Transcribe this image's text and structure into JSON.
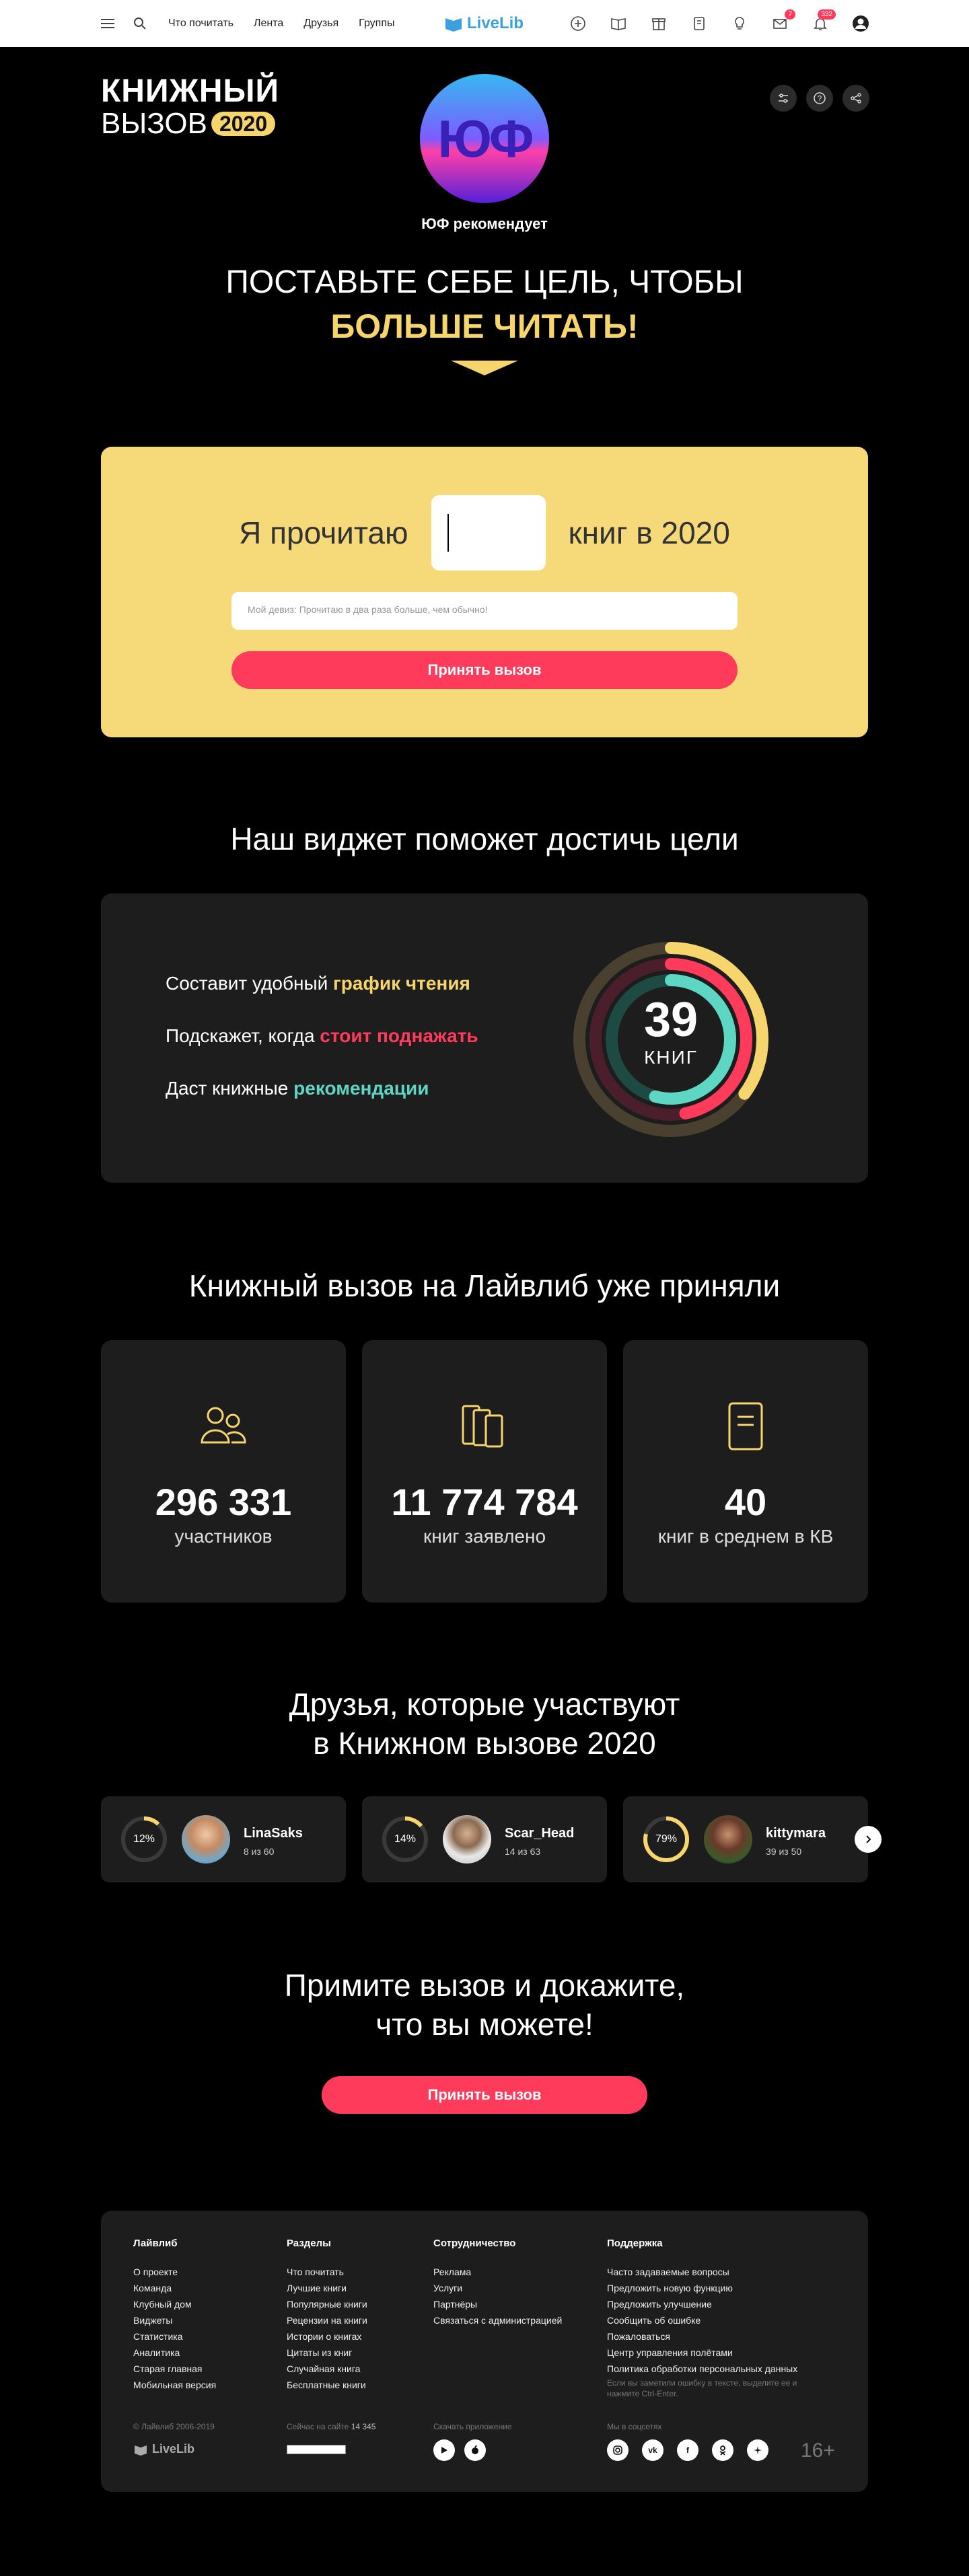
{
  "nav": {
    "links": [
      "Что почитать",
      "Лента",
      "Друзья",
      "Группы"
    ],
    "logo": "LiveLib",
    "messages_badge": "7",
    "notifications_badge": "332"
  },
  "hero": {
    "brand_line1": "КНИЖНЫЙ",
    "brand_line2": "ВЫЗОВ",
    "brand_year": "2020",
    "avatar_text": "ЮФ",
    "recommends": "ЮФ рекомендует",
    "headline1": "ПОСТАВЬТЕ СЕБЕ ЦЕЛЬ, ЧТОБЫ",
    "headline2": "БОЛЬШЕ ЧИТАТЬ!"
  },
  "goal": {
    "prefix": "Я прочитаю",
    "value": "",
    "suffix": "книг в 2020",
    "motto_placeholder": "Мой девиз: Прочитаю в два раза больше, чем обычно!",
    "button": "Принять вызов"
  },
  "widget": {
    "title": "Наш виджет поможет достичь цели",
    "line1_text": "Составит удобный ",
    "line1_hl": "график чтения",
    "line2_text": "Подскажет, когда ",
    "line2_hl": "стоит поднажать",
    "line3_text": "Даст книжные ",
    "line3_hl": "рекомендации",
    "ring_number": "39",
    "ring_unit": "КНИГ",
    "colors": {
      "yellow": "#f6d56c",
      "pink": "#ff3b5c",
      "teal": "#5ed6c4"
    }
  },
  "stats": {
    "title": "Книжный вызов на Лайвлиб уже приняли",
    "items": [
      {
        "num": "296 331",
        "label": "участников"
      },
      {
        "num": "11 774 784",
        "label": "книг заявлено"
      },
      {
        "num": "40",
        "label": "книг в среднем в КВ"
      }
    ]
  },
  "friends": {
    "title_line1": "Друзья, которые участвуют",
    "title_line2": "в Книжном вызове 2020",
    "items": [
      {
        "pct": "12%",
        "progress": 0.12,
        "name": "LinaSaks",
        "progress_text": "8 из 60"
      },
      {
        "pct": "14%",
        "progress": 0.14,
        "name": "Scar_Head",
        "progress_text": "14 из 63"
      },
      {
        "pct": "79%",
        "progress": 0.79,
        "name": "kittymara",
        "progress_text": "39 из 50"
      }
    ]
  },
  "cta": {
    "line1": "Примите вызов и докажите,",
    "line2": "что вы можете!",
    "button": "Принять вызов"
  },
  "footer": {
    "col1_title": "Лайвлиб",
    "col1": [
      "О проекте",
      "Команда",
      "Клубный дом",
      "Виджеты",
      "Статистика",
      "Аналитика",
      "Старая главная",
      "Мобильная версия"
    ],
    "col2_title": "Разделы",
    "col2": [
      "Что почитать",
      "Лучшие книги",
      "Популярные книги",
      "Рецензии на книги",
      "Истории о книгах",
      "Цитаты из книг",
      "Случайная книга",
      "Бесплатные книги"
    ],
    "col3_title": "Сотрудничество",
    "col3": [
      "Реклама",
      "Услуги",
      "Партнёры",
      "Связаться с администрацией"
    ],
    "col4_title": "Поддержка",
    "col4": [
      "Часто задаваемые вопросы",
      "Предложить новую функцию",
      "Предложить улучшение",
      "Сообщить об ошибке",
      "Пожаловаться",
      "Центр управления полётами",
      "Политика обработки персональных данных"
    ],
    "error_note": "Если вы заметили ошибку в тексте, выделите ее и нажмите Ctrl-Enter.",
    "copyright": "© Лайвлиб 2006-2019",
    "online_label": "Сейчас на сайте ",
    "online_count": "14 345",
    "apps_label": "Скачать приложение",
    "social_label": "Мы в соцсетях",
    "logo": "LiveLib",
    "age": "16+"
  }
}
